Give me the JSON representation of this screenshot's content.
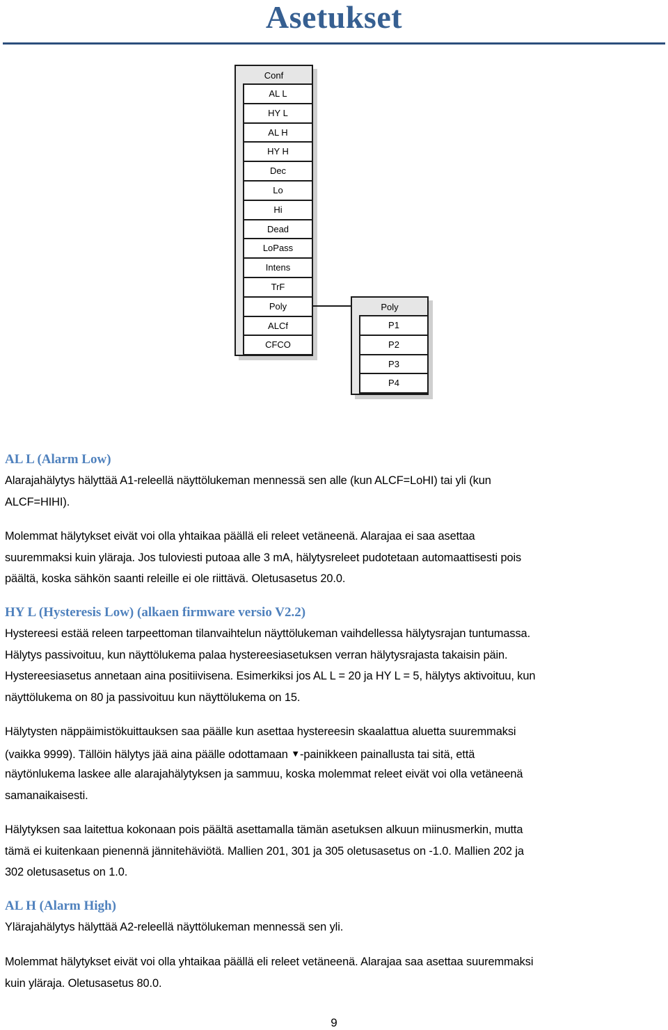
{
  "page": {
    "title": "Asetukset",
    "page_number": "9"
  },
  "diagram": {
    "conf_menu": {
      "header": "Conf",
      "items": [
        "AL L",
        "HY L",
        "AL H",
        "HY H",
        "Dec",
        "Lo",
        "Hi",
        "Dead",
        "LoPass",
        "Intens",
        "TrF",
        "Poly",
        "ALCf",
        "CFCO"
      ]
    },
    "poly_menu": {
      "header": "Poly",
      "items": [
        "P1",
        "P2",
        "P3",
        "P4"
      ]
    },
    "connection": {
      "from": "Poly",
      "to": "Poly"
    }
  },
  "sections": {
    "al_l": {
      "heading": "AL L (Alarm Low)",
      "lines": [
        "Alarajahälytys hälyttää A1-releellä näyttölukeman mennessä sen alle (kun ALCF=LoHI) tai yli (kun",
        "ALCF=HIHI).",
        "Molemmat hälytykset eivät voi olla yhtaikaa päällä eli releet vetäneenä. Alarajaa ei saa asettaa",
        "suuremmaksi kuin yläraja. Jos tuloviesti putoaa alle 3 mA, hälytysreleet pudotetaan automaattisesti pois",
        "päältä, koska sähkön saanti releille ei ole riittävä. Oletusasetus 20.0."
      ]
    },
    "hy_l": {
      "heading": "HY L (Hysteresis Low) (alkaen firmware versio V2.2)",
      "lines": [
        "Hystereesi estää releen tarpeettoman tilanvaihtelun näyttölukeman vaihdellessa hälytysrajan tuntumassa.",
        "Hälytys passivoituu, kun näyttölukema palaa hystereesiasetuksen verran hälytysrajasta takaisin päin.",
        "Hystereesiasetus annetaan aina positiivisena. Esimerkiksi jos AL L = 20 ja HY L = 5, hälytys aktivoituu, kun",
        "näyttölukema on 80 ja passivoituu kun näyttölukema on 15.",
        "Hälytysten näppäimistökuittauksen saa päälle kun asettaa hystereesin skaalattua aluetta suuremmaksi",
        "(vaikka 9999). Tällöin hälytys jää aina päälle odottamaan ",
        "-painikkeen painallusta tai sitä, että",
        "näytönlukema laskee alle alarajahälytyksen ja sammuu, koska molemmat releet eivät voi olla vetäneenä",
        "samanaikaisesti.",
        "Hälytyksen saa laitettua kokonaan pois päältä asettamalla tämän asetuksen alkuun miinusmerkin, mutta",
        "tämä ei kuitenkaan pienennä jännitehäviötä. Mallien 201, 301 ja 305 oletusasetus on  -1.0. Mallien 202 ja",
        "302 oletusasetus on 1.0."
      ],
      "down_button_glyph": "▼"
    },
    "al_h": {
      "heading": "AL H (Alarm High)",
      "lines": [
        "Ylärajahälytys hälyttää A2-releellä näyttölukeman mennessä sen yli.",
        "Molemmat hälytykset eivät voi olla yhtaikaa päällä eli releet vetäneenä. Alarajaa saa asettaa suuremmaksi",
        "kuin yläraja. Oletusasetus 80.0."
      ]
    }
  }
}
